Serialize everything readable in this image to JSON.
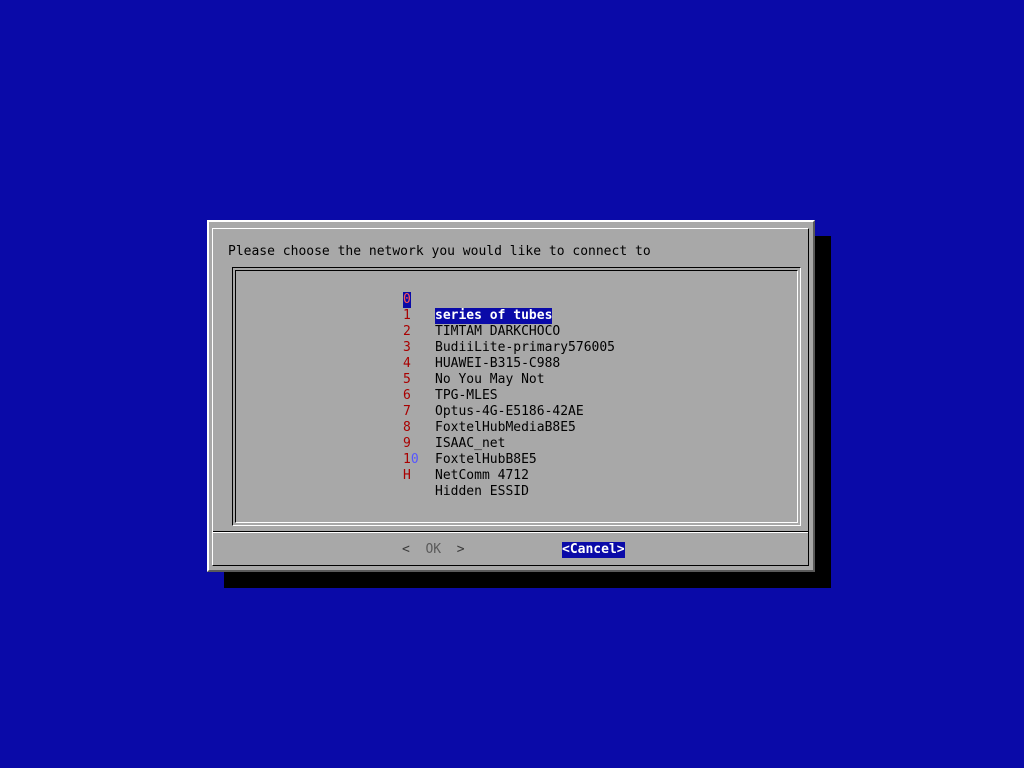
{
  "dialog": {
    "prompt": "Please choose the network you would like to connect to"
  },
  "networks": [
    {
      "tag": "0",
      "tag_extra": "",
      "label": "series of tubes"
    },
    {
      "tag": "1",
      "tag_extra": "",
      "label": "TIMTAM DARKCHOCO"
    },
    {
      "tag": "2",
      "tag_extra": "",
      "label": "BudiiLite-primary576005"
    },
    {
      "tag": "3",
      "tag_extra": "",
      "label": "HUAWEI-B315-C988"
    },
    {
      "tag": "4",
      "tag_extra": "",
      "label": "No You May Not"
    },
    {
      "tag": "5",
      "tag_extra": "",
      "label": "TPG-MLES"
    },
    {
      "tag": "6",
      "tag_extra": "",
      "label": "Optus-4G-E5186-42AE"
    },
    {
      "tag": "7",
      "tag_extra": "",
      "label": "FoxtelHubMediaB8E5"
    },
    {
      "tag": "8",
      "tag_extra": "",
      "label": "ISAAC_net"
    },
    {
      "tag": "9",
      "tag_extra": "",
      "label": "FoxtelHubB8E5"
    },
    {
      "tag": "1",
      "tag_extra": "0",
      "label": "NetComm 4712"
    },
    {
      "tag": "H",
      "tag_extra": "",
      "label": "Hidden ESSID"
    }
  ],
  "buttons": {
    "ok_left": "<",
    "ok_label": "OK",
    "ok_right": ">",
    "cancel_label": "<Cancel>"
  },
  "colors": {
    "background": "#0a0aa8",
    "dialog": "#a8a8a8",
    "tag": "#a80000",
    "highlight": "#0a0aa8"
  }
}
